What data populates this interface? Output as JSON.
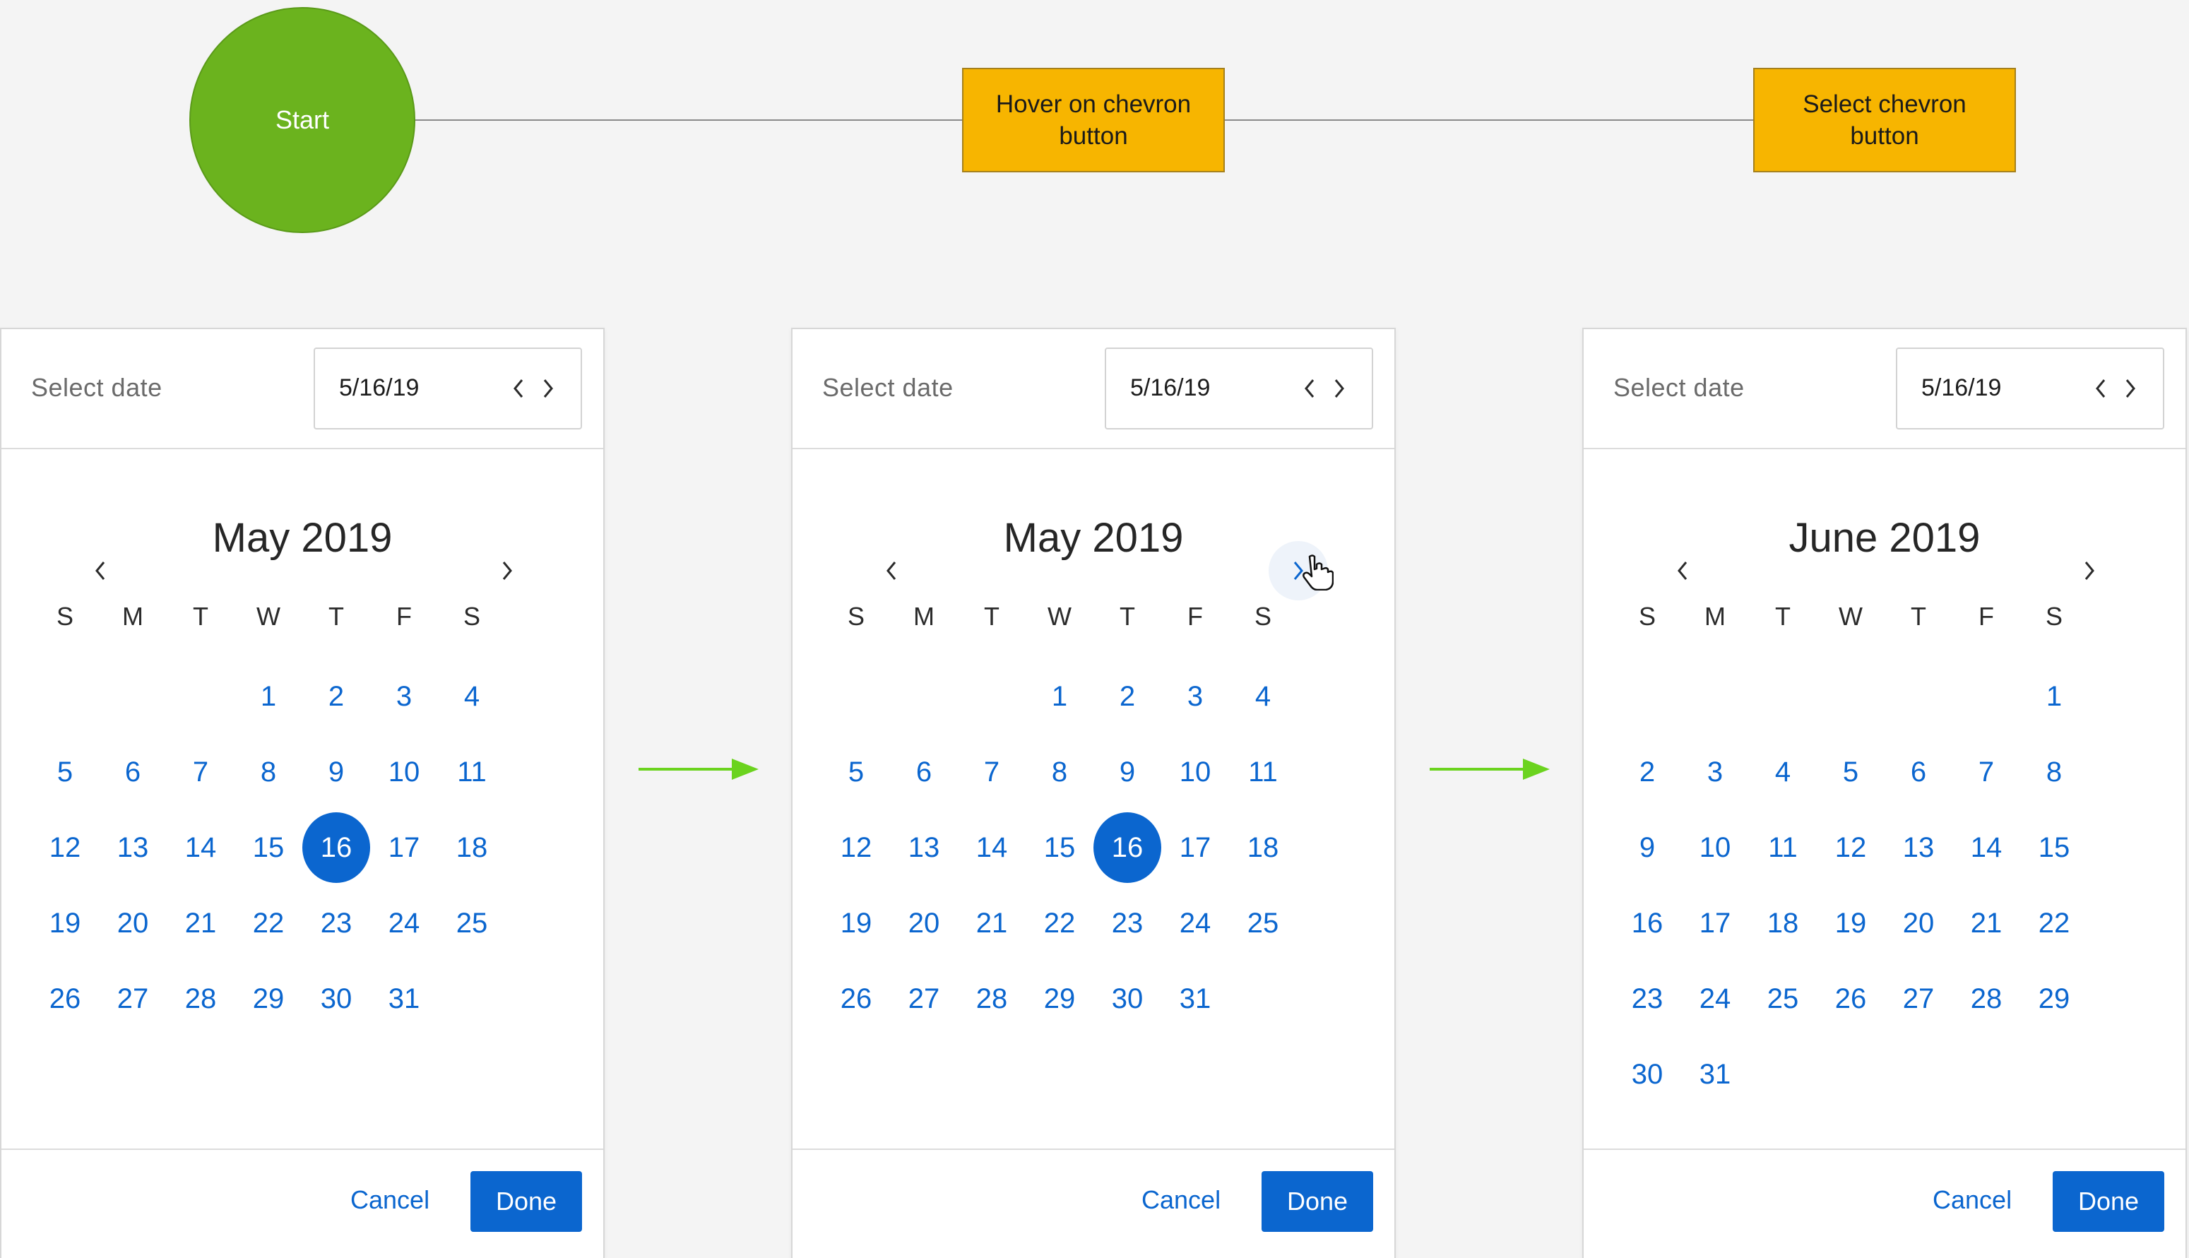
{
  "diagram": {
    "start_label": "Start",
    "steps": [
      "Hover on chevron button",
      "Select chevron button"
    ],
    "colors": {
      "start": "#6bb31e",
      "step": "#f7b500",
      "arrow": "#6bd31e"
    }
  },
  "panels": [
    {
      "header_label": "Select date",
      "input_value": "5/16/19",
      "month_title": "May 2019",
      "weekdays": [
        "S",
        "M",
        "T",
        "W",
        "T",
        "F",
        "S"
      ],
      "first_weekday": 3,
      "days_in_month": 31,
      "selected_day": 16,
      "next_chevron_state": "default",
      "cancel_label": "Cancel",
      "done_label": "Done"
    },
    {
      "header_label": "Select date",
      "input_value": "5/16/19",
      "month_title": "May 2019",
      "weekdays": [
        "S",
        "M",
        "T",
        "W",
        "T",
        "F",
        "S"
      ],
      "first_weekday": 3,
      "days_in_month": 31,
      "selected_day": 16,
      "next_chevron_state": "hover",
      "cancel_label": "Cancel",
      "done_label": "Done"
    },
    {
      "header_label": "Select date",
      "input_value": "5/16/19",
      "month_title": "June 2019",
      "weekdays": [
        "S",
        "M",
        "T",
        "W",
        "T",
        "F",
        "S"
      ],
      "first_weekday": 6,
      "days_in_month": 31,
      "selected_day": null,
      "next_chevron_state": "default",
      "cancel_label": "Cancel",
      "done_label": "Done"
    }
  ],
  "icons": {
    "input_prev": "chevron-left-icon",
    "input_next": "chevron-right-icon",
    "calendar_prev": "chevron-left-icon",
    "calendar_next": "chevron-right-icon",
    "cursor": "hand-pointer-cursor-icon",
    "flow_arrow": "arrow-right-icon"
  },
  "accent_color": "#0b66cf"
}
